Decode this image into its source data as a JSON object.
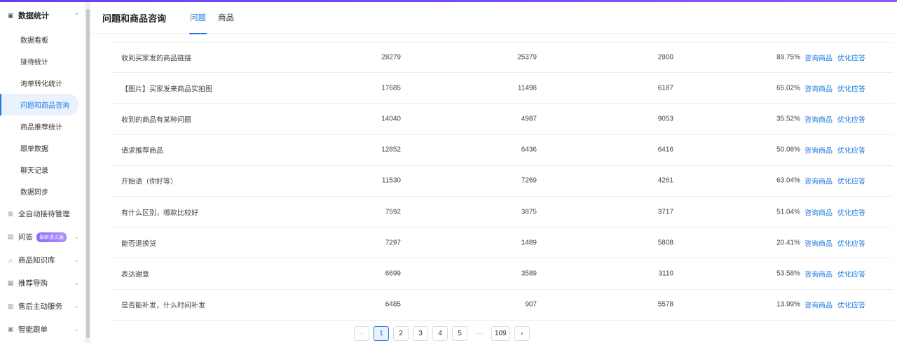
{
  "sidebar": {
    "group": {
      "label": "数据统计",
      "icon": "chart-icon"
    },
    "sub_items": [
      {
        "label": "数据看板"
      },
      {
        "label": "接待统计"
      },
      {
        "label": "询单转化统计"
      },
      {
        "label": "问题和商品咨询"
      },
      {
        "label": "商品推荐统计"
      },
      {
        "label": "跟单数据"
      },
      {
        "label": "聊天记录"
      },
      {
        "label": "数据同步"
      }
    ],
    "nav_items": [
      {
        "label": "全自动接待管理",
        "icon": "robot-icon"
      },
      {
        "label": "问答",
        "badge": "最新语义版",
        "icon": "chat-icon"
      },
      {
        "label": "商品知识库",
        "icon": "store-icon"
      },
      {
        "label": "推荐导购",
        "icon": "guide-icon"
      },
      {
        "label": "售后主动服务",
        "icon": "service-icon"
      },
      {
        "label": "智能跟单",
        "icon": "follow-icon"
      }
    ]
  },
  "header": {
    "title": "问题和商品咨询",
    "tabs": [
      {
        "label": "问题"
      },
      {
        "label": "商品"
      }
    ]
  },
  "table": {
    "rows": [
      {
        "name": "收到买家发的商品链接",
        "a": "28279",
        "b": "25379",
        "c": "2900",
        "d": "89.75%"
      },
      {
        "name": "【图片】买家发来商品实拍图",
        "a": "17685",
        "b": "11498",
        "c": "6187",
        "d": "65.02%"
      },
      {
        "name": "收到的商品有某种问题",
        "a": "14040",
        "b": "4987",
        "c": "9053",
        "d": "35.52%"
      },
      {
        "name": "请求推荐商品",
        "a": "12852",
        "b": "6436",
        "c": "6416",
        "d": "50.08%"
      },
      {
        "name": "开始语（你好等）",
        "a": "11530",
        "b": "7269",
        "c": "4261",
        "d": "63.04%"
      },
      {
        "name": "有什么区别，哪款比较好",
        "a": "7592",
        "b": "3875",
        "c": "3717",
        "d": "51.04%"
      },
      {
        "name": "能否退换货",
        "a": "7297",
        "b": "1489",
        "c": "5808",
        "d": "20.41%"
      },
      {
        "name": "表达谢意",
        "a": "6699",
        "b": "3589",
        "c": "3110",
        "d": "53.58%"
      },
      {
        "name": "是否能补发，什么时间补发",
        "a": "6485",
        "b": "907",
        "c": "5578",
        "d": "13.99%"
      }
    ],
    "link1": "咨询商品",
    "link2": "优化应答"
  },
  "pager": {
    "prev": "‹",
    "next": "›",
    "pages": [
      "1",
      "2",
      "3",
      "4",
      "5"
    ],
    "dots": "···",
    "last": "109",
    "current": "1"
  }
}
